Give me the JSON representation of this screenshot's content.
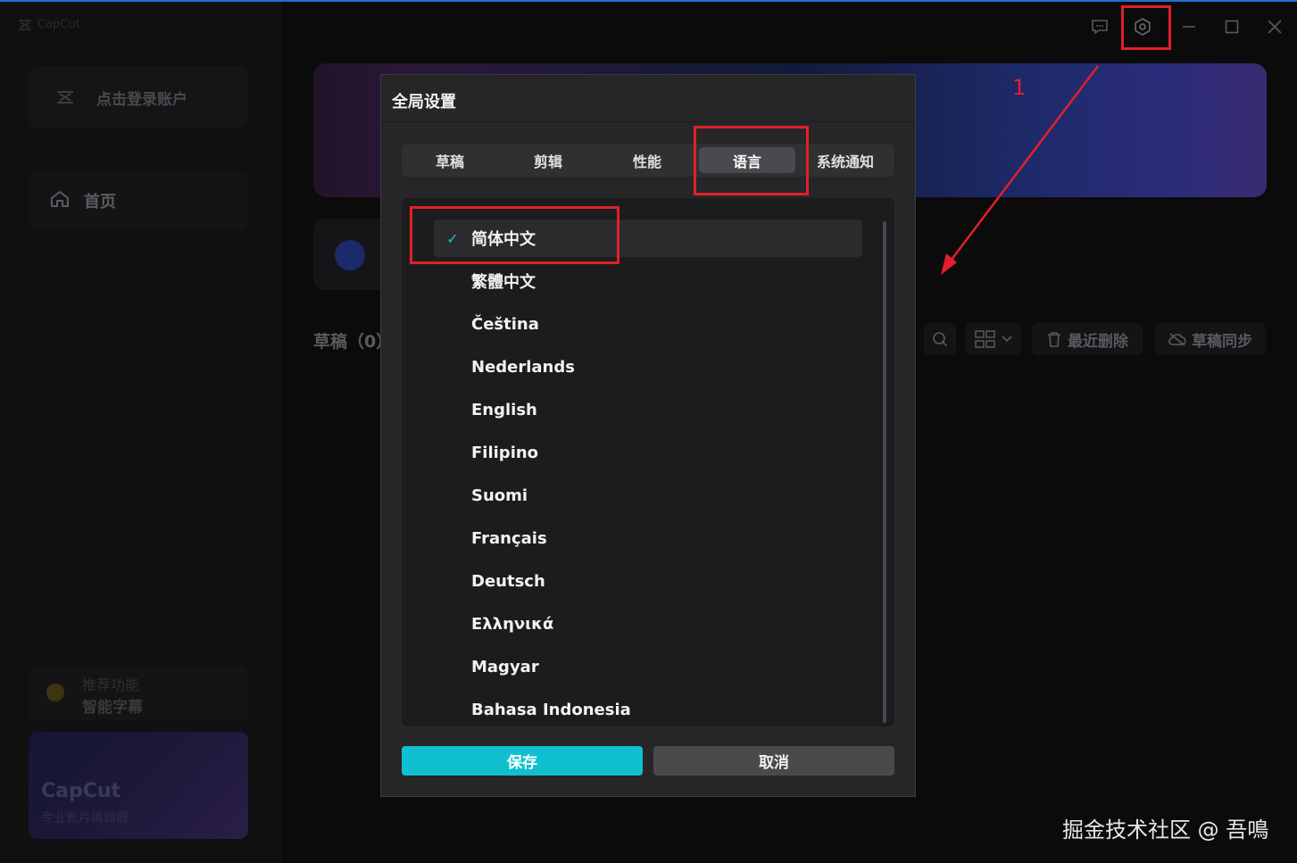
{
  "app": {
    "logo_text": "CapCut",
    "login_label": "点击登录账户",
    "home_label": "首页",
    "promo": {
      "subtitle": "推荐功能",
      "title": "智能字幕"
    },
    "ad": {
      "title": "CapCut",
      "subtitle": "专业影片编辑器"
    },
    "drafts_title": "草稿（0）",
    "toolbar": {
      "recent_delete": "最近删除",
      "draft_sync": "草稿同步"
    }
  },
  "dialog": {
    "title": "全局设置",
    "tabs": [
      "草稿",
      "剪辑",
      "性能",
      "语言",
      "系统通知"
    ],
    "active_tab": "语言",
    "languages": [
      "简体中文",
      "繁體中文",
      "Čeština",
      "Nederlands",
      "English",
      "Filipino",
      "Suomi",
      "Français",
      "Deutsch",
      "Ελληνικά",
      "Magyar",
      "Bahasa Indonesia"
    ],
    "selected_language": "简体中文",
    "check_mark": "✓",
    "save_label": "保存",
    "cancel_label": "取消"
  },
  "annotation": {
    "number": "1",
    "color": "#e0202a"
  },
  "watermark": "掘金技术社区 @ 吾鳴",
  "colors": {
    "accent": "#10c0d0",
    "highlight": "#e0202a",
    "dialog_bg": "#262628"
  }
}
